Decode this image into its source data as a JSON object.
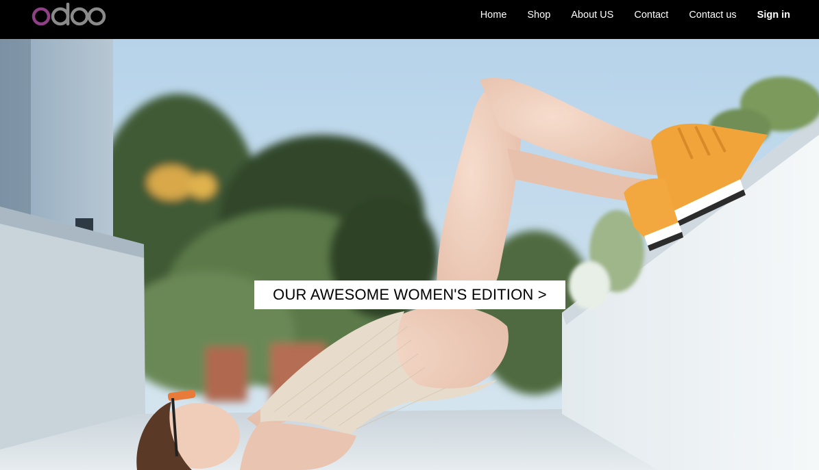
{
  "brand": {
    "name": "odoo",
    "colors": {
      "o_first": "#8f3f85",
      "rest": "#8a8a8a"
    }
  },
  "nav": {
    "items": [
      {
        "label": "Home"
      },
      {
        "label": "Shop"
      },
      {
        "label": "About US"
      },
      {
        "label": "Contact"
      },
      {
        "label": "Contact us"
      },
      {
        "label": "Sign in"
      }
    ]
  },
  "hero": {
    "cta_label": "OUR AWESOME WOMEN'S EDITION >",
    "image": "woman-lying-with-orange-sneakers-on-wall"
  }
}
